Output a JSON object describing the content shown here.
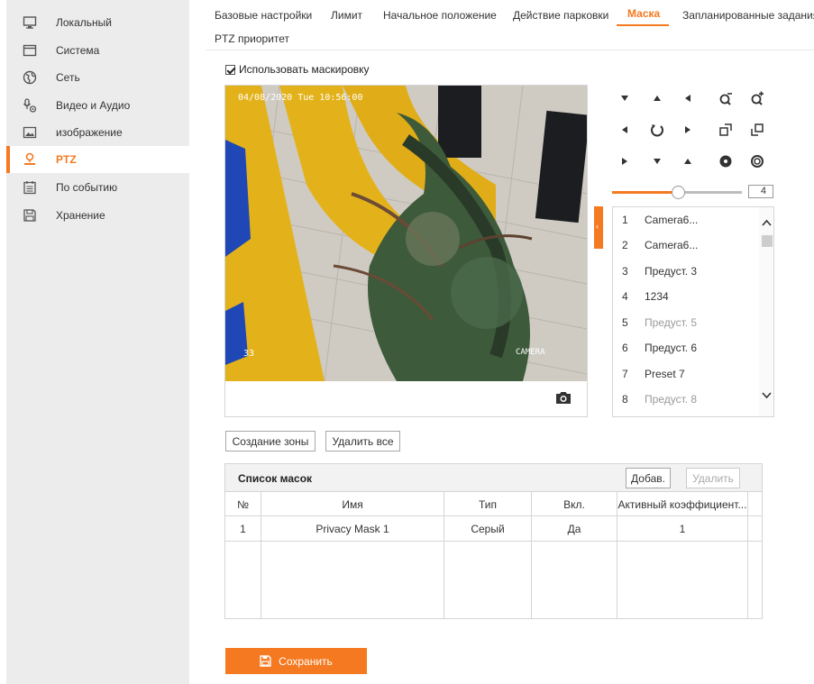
{
  "sidebar": {
    "items": [
      {
        "label": "Локальный",
        "icon": "monitor-icon"
      },
      {
        "label": "Система",
        "icon": "window-icon"
      },
      {
        "label": "Сеть",
        "icon": "globe-icon"
      },
      {
        "label": "Видео и Аудио",
        "icon": "microphone-camera-icon"
      },
      {
        "label": "изображение",
        "icon": "image-icon"
      },
      {
        "label": "PTZ",
        "icon": "ptz-icon",
        "active": true
      },
      {
        "label": "По событию",
        "icon": "calendar-icon"
      },
      {
        "label": "Хранение",
        "icon": "floppy-icon"
      }
    ]
  },
  "tabs": {
    "items": [
      "Базовые настройки",
      "Лимит",
      "Начальное положение",
      "Действие парковки",
      "Маска",
      "Запланированные задания",
      "PTZ приоритет"
    ],
    "active": "Маска"
  },
  "mask_enable": {
    "label": "Использовать маскировку",
    "checked": true
  },
  "video": {
    "timestamp": "04/08/2020 Tue 10:56:00",
    "camera_name": "CAMERA",
    "number": "33"
  },
  "ptz": {
    "speed_value": "4",
    "speed_fraction": 0.51
  },
  "presets": [
    {
      "num": "1",
      "name": "Camera6...",
      "defined": true
    },
    {
      "num": "2",
      "name": "Camera6...",
      "defined": true
    },
    {
      "num": "3",
      "name": "Предуст. 3",
      "defined": true
    },
    {
      "num": "4",
      "name": "1234",
      "defined": true
    },
    {
      "num": "5",
      "name": "Предуст. 5",
      "defined": false
    },
    {
      "num": "6",
      "name": "Предуст. 6",
      "defined": true
    },
    {
      "num": "7",
      "name": "Preset 7",
      "defined": true
    },
    {
      "num": "8",
      "name": "Предуст. 8",
      "defined": false
    }
  ],
  "buttons": {
    "create_zone": "Создание зоны",
    "delete_all": "Удалить все",
    "add": "Добав.",
    "delete": "Удалить",
    "save": "Сохранить"
  },
  "mask_list": {
    "title": "Список масок",
    "columns": [
      "№",
      "Имя",
      "Тип",
      "Вкл.",
      "Активный коэффициент..."
    ],
    "rows": [
      {
        "no": "1",
        "name": "Privacy Mask 1",
        "type": "Серый",
        "enabled": "Да",
        "ratio": "1"
      }
    ]
  },
  "colors": {
    "accent": "#f47920",
    "sidebar_bg": "#ececec"
  }
}
